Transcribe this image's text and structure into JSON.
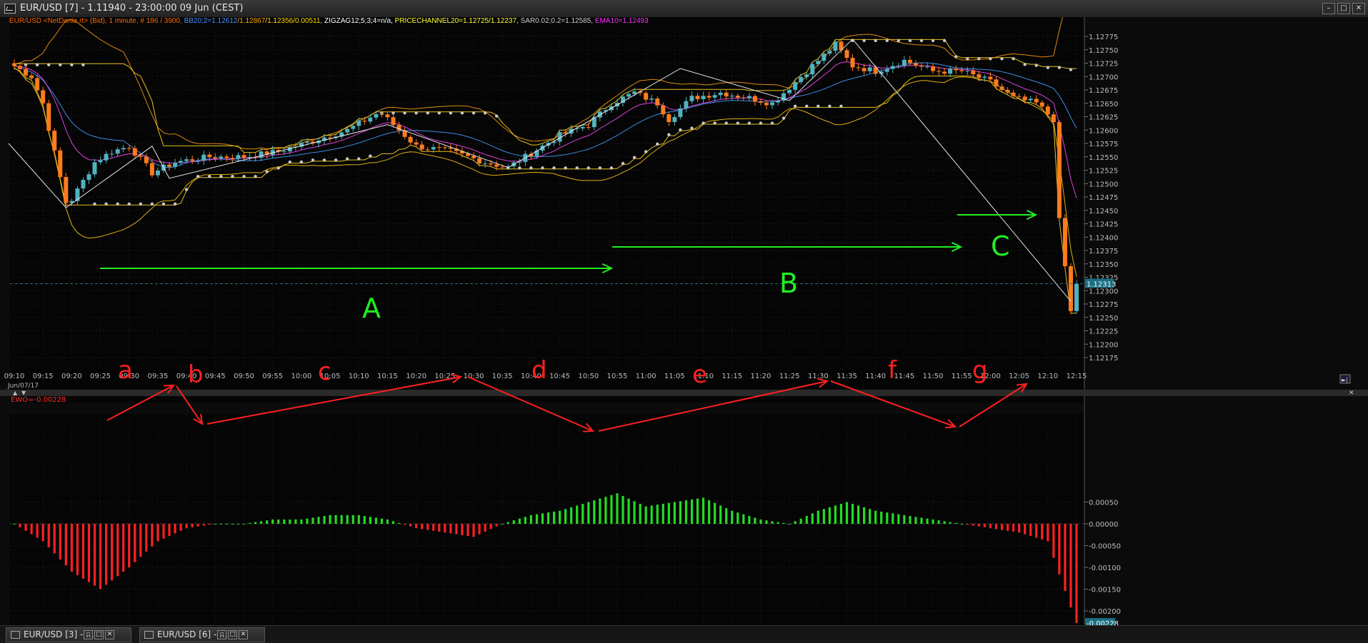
{
  "window": {
    "title": "EUR/USD [7] - 1.11940 - 23:00:00  09 Jun (CEST)",
    "buttons": [
      "–",
      "□",
      "✕"
    ]
  },
  "legend": [
    {
      "text": "EUR/USD <NetDania rt> (Bid), 1 minute, # 186 / 3900, ",
      "color": "#ff6a00"
    },
    {
      "text": "BB20;2=1.12612",
      "color": "#4a90ff"
    },
    {
      "text": "/1.12867",
      "color": "#ffa500"
    },
    {
      "text": "/1.12356",
      "color": "#ffd700"
    },
    {
      "text": "/0.00511, ",
      "color": "#ffd700"
    },
    {
      "text": "ZIGZAG12;5;3;4=n/a, ",
      "color": "#ffffff"
    },
    {
      "text": "PRICECHANNEL20=1.12725/1.12237, ",
      "color": "#ffff33"
    },
    {
      "text": "SAR0.02;0.2=1.12585, ",
      "color": "#d0d0d0"
    },
    {
      "text": "EMA10=1.12493",
      "color": "#ff33ff"
    }
  ],
  "price_axis": {
    "labels": [
      "1.12775",
      "1.12750",
      "1.12725",
      "1.12700",
      "1.12675",
      "1.12650",
      "1.12625",
      "1.12600",
      "1.12575",
      "1.12550",
      "1.12525",
      "1.12500",
      "1.12475",
      "1.12450",
      "1.12425",
      "1.12400",
      "1.12375",
      "1.12350",
      "1.12325",
      "1.12300",
      "1.12275",
      "1.12250",
      "1.12225",
      "1.12200",
      "1.12175"
    ],
    "current_price_label": "1.12313"
  },
  "time_axis": {
    "labels": [
      "09:10",
      "09:15",
      "09:20",
      "09:25",
      "09:30",
      "09:35",
      "09:40",
      "09:45",
      "09:50",
      "09:55",
      "10:00",
      "10:05",
      "10:10",
      "10:15",
      "10:20",
      "10:25",
      "10:30",
      "10:35",
      "10:40",
      "10:45",
      "10:50",
      "10:55",
      "11:00",
      "11:05",
      "11:10",
      "11:15",
      "11:20",
      "11:25",
      "11:30",
      "11:35",
      "11:40",
      "11:45",
      "11:50",
      "11:55",
      "12:00",
      "12:05",
      "12:10",
      "12:15"
    ],
    "date": "Jun/07/17"
  },
  "ewo": {
    "label": "EWO=-0.00228",
    "axis_labels": [
      "0.00050",
      "0.00000",
      "-0.00050",
      "-0.00100",
      "-0.00150",
      "-0.00200"
    ],
    "current_label": "-0.00228"
  },
  "annotations": {
    "wave_labels_green": [
      "A",
      "B",
      "C"
    ],
    "wave_labels_red": [
      "a",
      "b",
      "c",
      "d",
      "e",
      "f",
      "g"
    ]
  },
  "tabs": [
    "EUR/USD [3] - ...",
    "EUR/USD [6] - ..."
  ],
  "colors": {
    "bull_candle": "#4fb3bf",
    "bear_candle": "#ff7b1c",
    "ewo_positive": "#22dd22",
    "ewo_negative": "#ff2020",
    "green_annotation": "#22ee22",
    "red_annotation": "#ff2020"
  },
  "chart_data": {
    "type": "line",
    "title": "EUR/USD",
    "xlabel": "",
    "ylabel": "",
    "ylim": [
      1.12165,
      1.12795
    ],
    "x": [
      "09:10",
      "09:15",
      "09:20",
      "09:25",
      "09:30",
      "09:35",
      "09:40",
      "09:45",
      "09:50",
      "09:55",
      "10:00",
      "10:05",
      "10:10",
      "10:15",
      "10:20",
      "10:25",
      "10:30",
      "10:35",
      "10:40",
      "10:45",
      "10:50",
      "10:55",
      "11:00",
      "11:05",
      "11:10",
      "11:15",
      "11:20",
      "11:25",
      "11:30",
      "11:35",
      "11:40",
      "11:45",
      "11:50",
      "11:55",
      "12:00",
      "12:05",
      "12:10",
      "12:15"
    ],
    "series": [
      {
        "name": "EUR/USD (Bid), 1 minute",
        "values": [
          1.1271,
          1.1265,
          1.1245,
          1.1255,
          1.1257,
          1.1253,
          1.1254,
          1.1255,
          1.1255,
          1.1257,
          1.1258,
          1.1259,
          1.1261,
          1.1257,
          1.1256,
          1.1255,
          1.1253,
          1.1256,
          1.1259,
          1.1262,
          1.1263,
          1.1267,
          1.1264,
          1.1266,
          1.1268,
          1.1266,
          1.1265,
          1.1268,
          1.1273,
          1.1272,
          1.127,
          1.1272,
          1.1272,
          1.1271,
          1.1269,
          1.1265,
          1.1264,
          1.12313
        ]
      },
      {
        "name": "EWO",
        "values": [
          -0.0,
          -0.0004,
          -0.0011,
          -0.0015,
          -0.001,
          -0.0004,
          -0.0001,
          0.0,
          0.0,
          0.0001,
          0.0001,
          0.0002,
          0.0002,
          0.0001,
          -0.0001,
          -0.0002,
          -0.0003,
          0.0,
          0.0002,
          0.0003,
          0.0005,
          0.0007,
          0.0004,
          0.0005,
          0.0006,
          0.0003,
          0.0001,
          0.0,
          0.0003,
          0.0005,
          0.0003,
          0.0002,
          0.0001,
          0.0,
          -0.0001,
          -0.0002,
          -0.0004,
          -0.00228
        ]
      }
    ]
  }
}
